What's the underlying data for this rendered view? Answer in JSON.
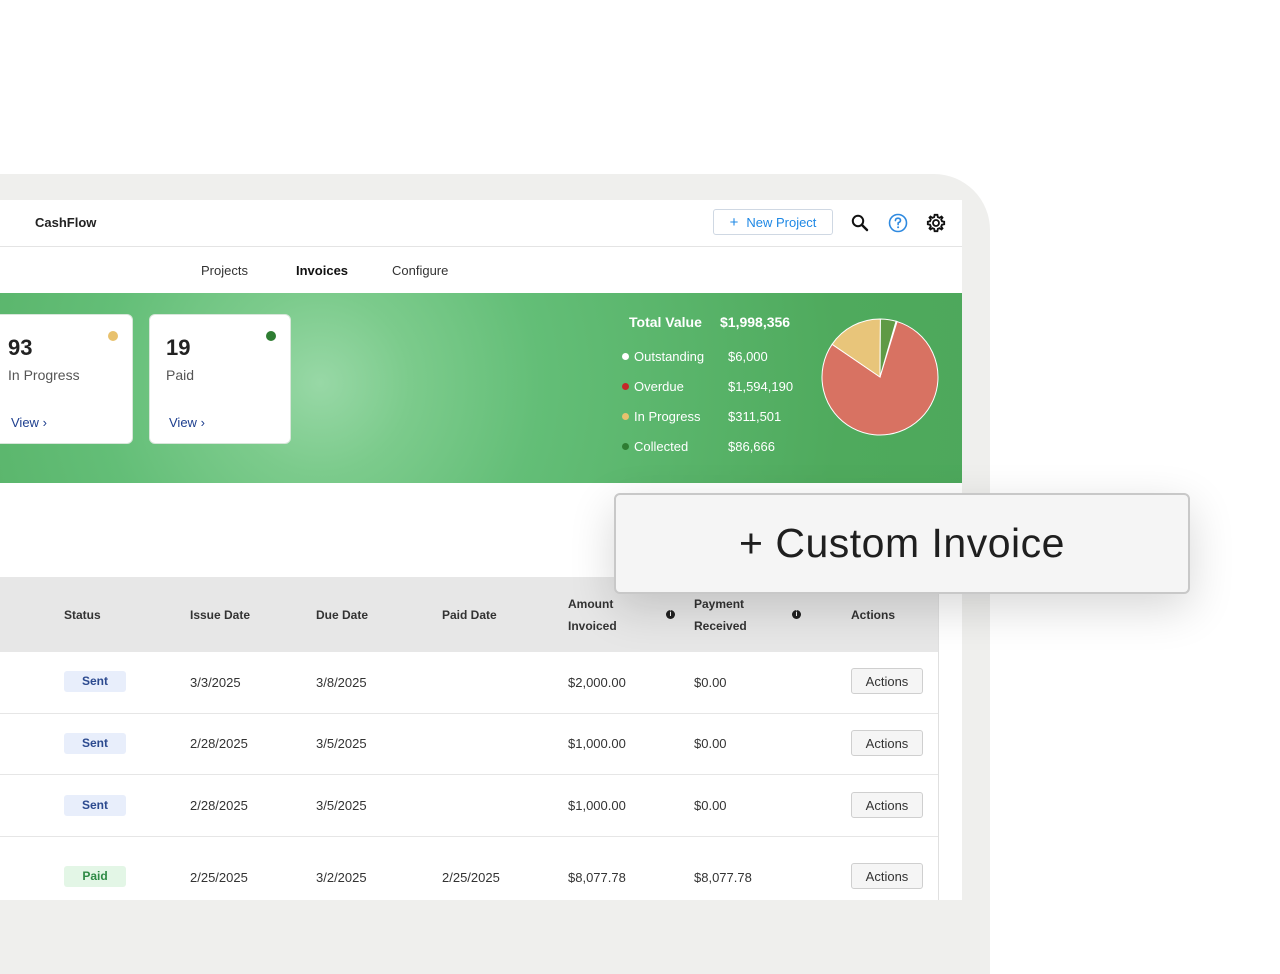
{
  "app": {
    "brand": "CashFlow"
  },
  "header": {
    "new_project_label": "New Project",
    "new_project_plus": "+"
  },
  "tabs": [
    {
      "label": "Projects",
      "active": false
    },
    {
      "label": "Invoices",
      "active": true
    },
    {
      "label": "Configure",
      "active": false
    }
  ],
  "cards": [
    {
      "count": "93",
      "label": "In Progress",
      "link": "View",
      "dot_color": "#e8c16d"
    },
    {
      "count": "19",
      "label": "Paid",
      "link": "View",
      "dot_color": "#2e7d32"
    }
  ],
  "summary": {
    "title": "Total Value",
    "total": "$1,998,356",
    "items": [
      {
        "label": "Outstanding",
        "value": "$6,000",
        "color": "#ffffff"
      },
      {
        "label": "Overdue",
        "value": "$1,594,190",
        "color": "#c62828"
      },
      {
        "label": "In Progress",
        "value": "$311,501",
        "color": "#e8c16d"
      },
      {
        "label": "Collected",
        "value": "$86,666",
        "color": "#2e7d32"
      }
    ]
  },
  "chart_data": {
    "type": "pie",
    "categories": [
      "Outstanding",
      "Overdue",
      "In Progress",
      "Collected"
    ],
    "values": [
      6000,
      1594190,
      311501,
      86666
    ],
    "colors": [
      "#ffffff",
      "#d87262",
      "#e8c57a",
      "#5f9a45"
    ]
  },
  "custom_invoice_label": "+ Custom Invoice",
  "table": {
    "headers": {
      "status": "Status",
      "issue_date": "Issue Date",
      "due_date": "Due Date",
      "paid_date": "Paid Date",
      "amount_invoiced_1": "Amount",
      "amount_invoiced_2": "Invoiced",
      "payment_received_1": "Payment",
      "payment_received_2": "Received",
      "actions": "Actions"
    },
    "rows": [
      {
        "status": "Sent",
        "issue": "3/3/2025",
        "due": "3/8/2025",
        "paid": "",
        "invoiced": "$2,000.00",
        "received": "$0.00",
        "action": "Actions"
      },
      {
        "status": "Sent",
        "issue": "2/28/2025",
        "due": "3/5/2025",
        "paid": "",
        "invoiced": "$1,000.00",
        "received": "$0.00",
        "action": "Actions"
      },
      {
        "status": "Sent",
        "issue": "2/28/2025",
        "due": "3/5/2025",
        "paid": "",
        "invoiced": "$1,000.00",
        "received": "$0.00",
        "action": "Actions"
      },
      {
        "status": "Paid",
        "issue": "2/25/2025",
        "due": "3/2/2025",
        "paid": "2/25/2025",
        "invoiced": "$8,077.78",
        "received": "$8,077.78",
        "action": "Actions"
      }
    ]
  }
}
